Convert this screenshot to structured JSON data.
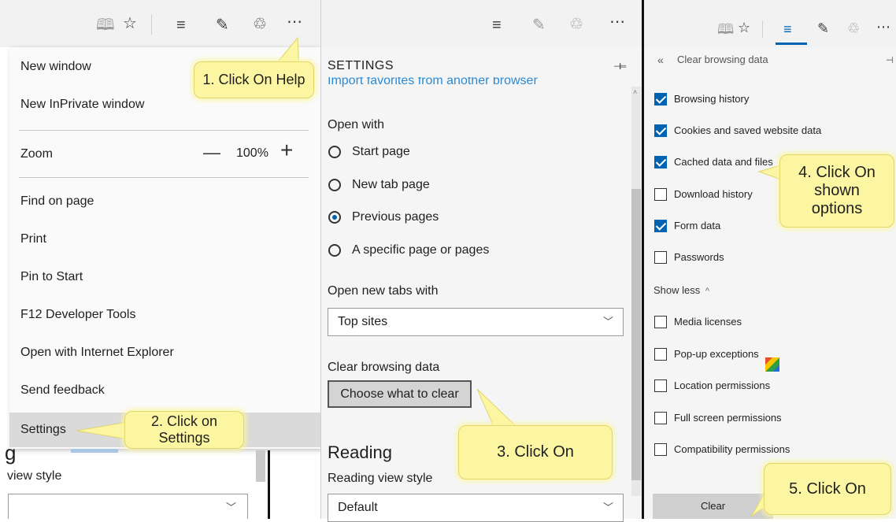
{
  "panel1": {
    "menu": {
      "new_window": "New window",
      "new_inprivate": "New InPrivate window",
      "zoom_label": "Zoom",
      "zoom_minus": "—",
      "zoom_value": "100%",
      "zoom_plus": "+",
      "find": "Find on page",
      "print": "Print",
      "pin": "Pin to Start",
      "devtools": "F12 Developer Tools",
      "open_ie": "Open with Internet Explorer",
      "feedback": "Send feedback",
      "settings": "Settings"
    },
    "behind": {
      "frag1": "g",
      "frag2": "view style",
      "chev": "﹀"
    },
    "callout1": "1. Click On Help",
    "callout2_l1": "2. Click on",
    "callout2_l2": "Settings"
  },
  "panel2": {
    "title": "SETTINGS",
    "pin": "⊣⊨",
    "link": "Import favorites from another browser",
    "open_with": "Open with",
    "radios": [
      "Start page",
      "New tab page",
      "Previous pages",
      "A specific page or pages"
    ],
    "open_tabs_label": "Open new tabs with",
    "open_tabs_value": "Top sites",
    "clear_label": "Clear browsing data",
    "clear_button": "Choose what to clear",
    "reading": "Reading",
    "reading_style_label": "Reading view style",
    "reading_style_value": "Default",
    "callout3": "3. Click On"
  },
  "panel3": {
    "back": "«",
    "title": "Clear browsing data",
    "items": [
      {
        "label": "Browsing history",
        "checked": true
      },
      {
        "label": "Cookies and saved website data",
        "checked": true
      },
      {
        "label": "Cached data and files",
        "checked": true
      },
      {
        "label": "Download history",
        "checked": false
      },
      {
        "label": "Form data",
        "checked": true
      },
      {
        "label": "Passwords",
        "checked": false
      }
    ],
    "show_less": "Show less",
    "show_less_icon": "^",
    "items2": [
      {
        "label": "Media licenses",
        "checked": false
      },
      {
        "label": "Pop-up exceptions",
        "checked": false
      },
      {
        "label": "Location permissions",
        "checked": false
      },
      {
        "label": "Full screen permissions",
        "checked": false
      },
      {
        "label": "Compatibility permissions",
        "checked": false
      }
    ],
    "clear_button": "Clear",
    "callout4_l1": "4. Click On",
    "callout4_l2": "shown",
    "callout4_l3": "options",
    "callout5": "5. Click On"
  },
  "colors": {
    "accent": "#0063b1",
    "callout": "#fcf6a3",
    "link": "#2b8ad3"
  },
  "icons": [
    "reading-view-icon",
    "favorites-star-icon",
    "hub-icon",
    "web-note-icon",
    "share-icon",
    "more-icon",
    "pin-icon",
    "chevron-down-icon",
    "chevron-up-icon",
    "back-icon",
    "cursor-icon"
  ]
}
